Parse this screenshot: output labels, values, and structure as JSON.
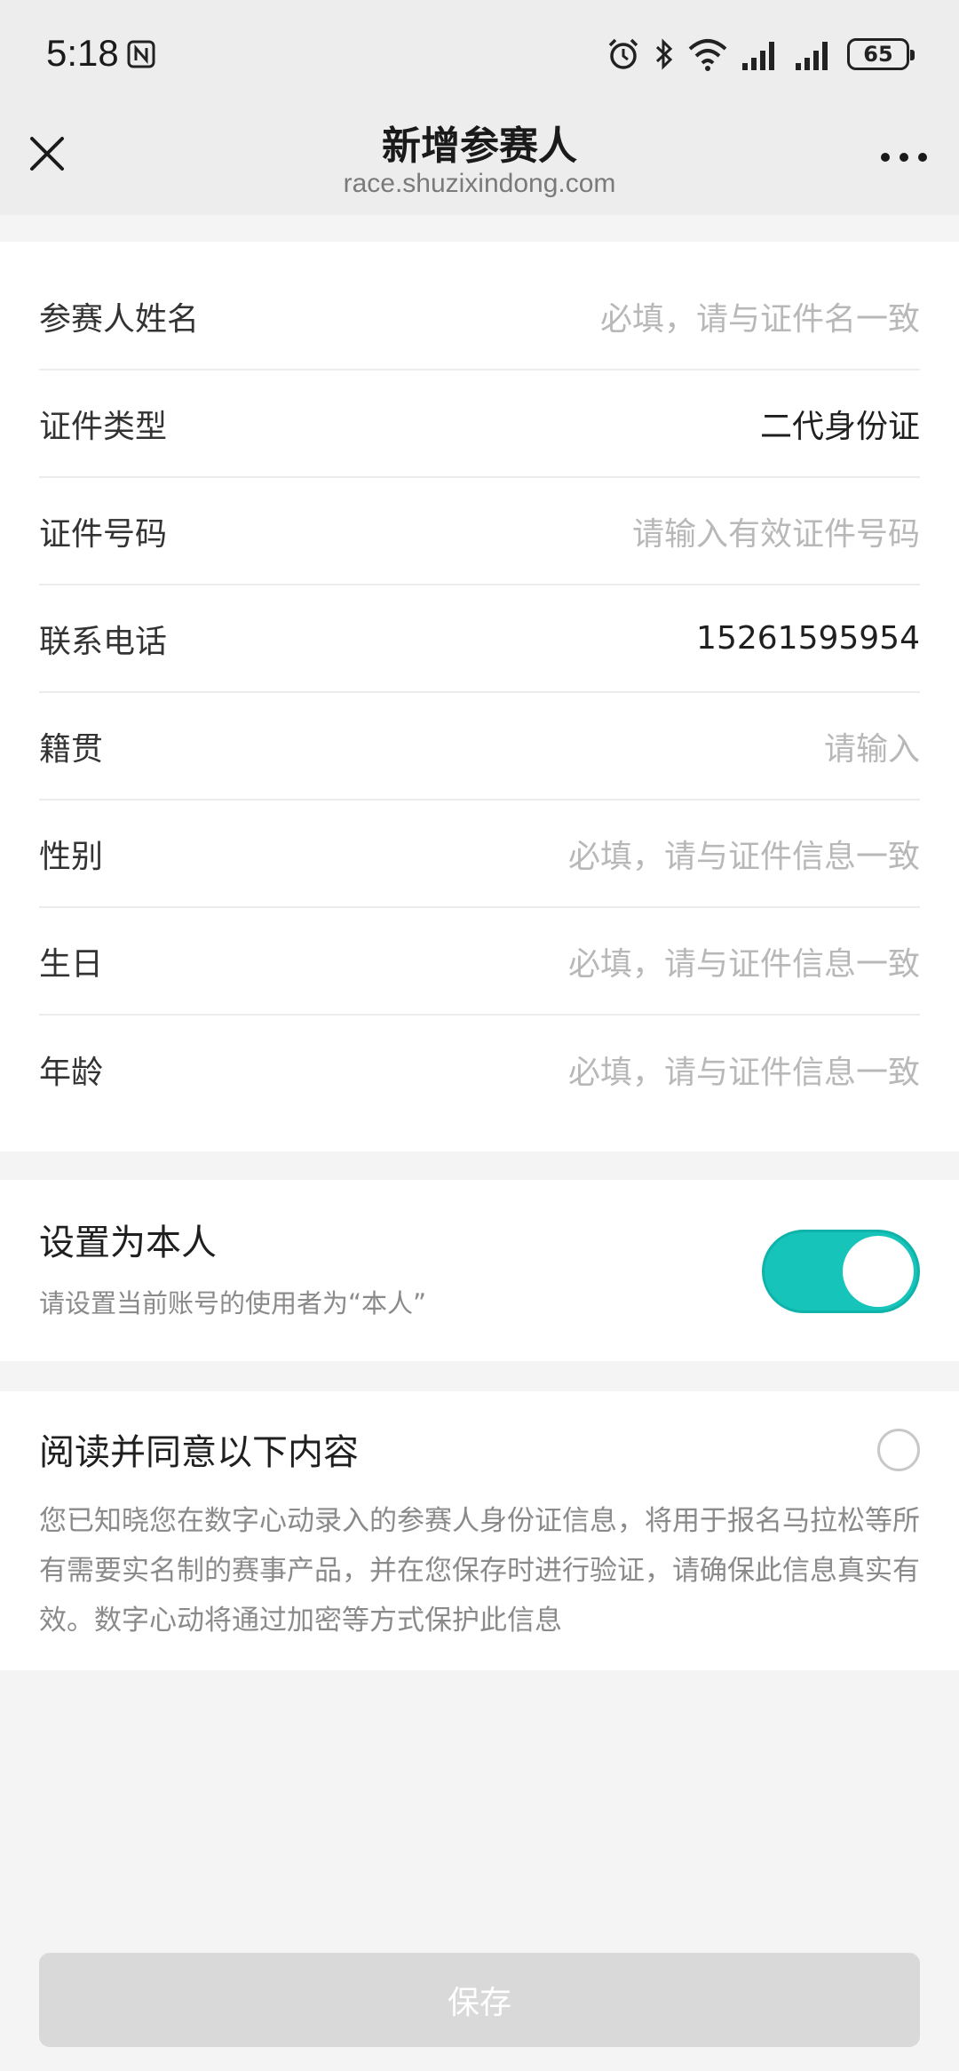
{
  "status_bar": {
    "time": "5:18",
    "battery": "65"
  },
  "header": {
    "title": "新增参赛人",
    "url": "race.shuzixindong.com"
  },
  "form": {
    "rows": [
      {
        "label": "参赛人姓名",
        "value": "必填，请与证件名一致",
        "is_placeholder": true
      },
      {
        "label": "证件类型",
        "value": "二代身份证",
        "is_placeholder": false
      },
      {
        "label": "证件号码",
        "value": "请输入有效证件号码",
        "is_placeholder": true
      },
      {
        "label": "联系电话",
        "value": "15261595954",
        "is_placeholder": false
      },
      {
        "label": "籍贯",
        "value": "请输入",
        "is_placeholder": true
      },
      {
        "label": "性别",
        "value": "必填，请与证件信息一致",
        "is_placeholder": true
      },
      {
        "label": "生日",
        "value": "必填，请与证件信息一致",
        "is_placeholder": true
      },
      {
        "label": "年龄",
        "value": "必填，请与证件信息一致",
        "is_placeholder": true
      }
    ]
  },
  "self_setting": {
    "title": "设置为本人",
    "description": "请设置当前账号的使用者为“本人”",
    "enabled": true
  },
  "agreement": {
    "title": "阅读并同意以下内容",
    "text": "您已知晓您在数字心动录入的参赛人身份证信息，将用于报名马拉松等所有需要实名制的赛事产品，并在您保存时进行验证，请确保此信息真实有效。数字心动将通过加密等方式保护此信息",
    "checked": false
  },
  "actions": {
    "save_label": "保存"
  },
  "colors": {
    "accent": "#16c4ba",
    "disabled_button": "#d9d9d9",
    "placeholder": "#b8b8b8"
  }
}
